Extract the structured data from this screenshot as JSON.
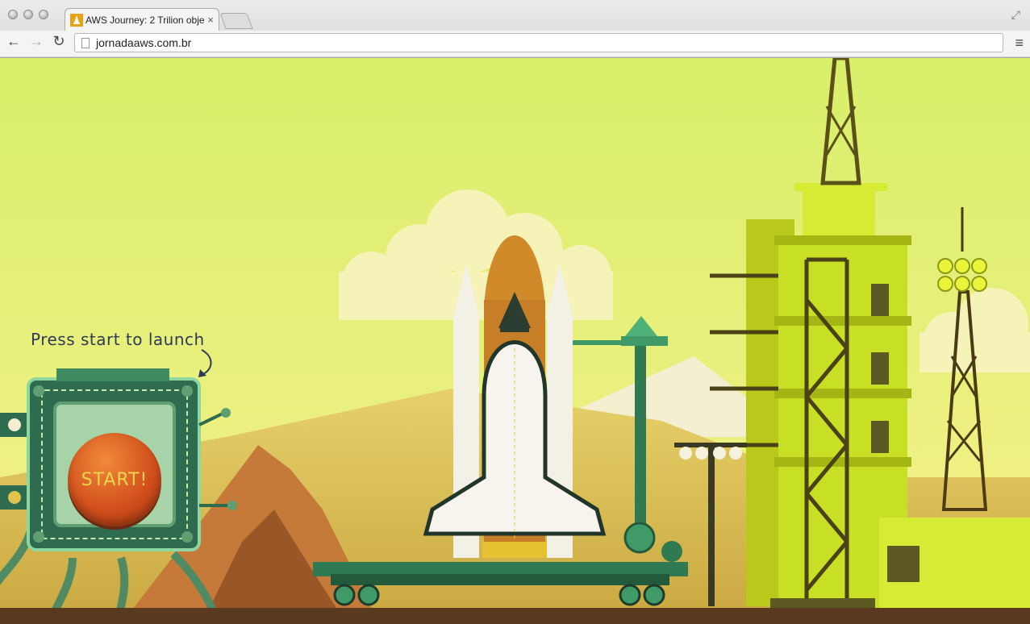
{
  "browser": {
    "tab": {
      "title": "AWS Journey: 2 Trilion obje",
      "close": "×"
    },
    "address": {
      "url": "jornadaaws.com.br"
    },
    "nav": {
      "back": "←",
      "forward": "→",
      "reload": "↻",
      "menu": "≡",
      "fullscreen": "⤢"
    }
  },
  "page": {
    "caption": "Press start to launch",
    "start_label": "START!"
  },
  "colors": {
    "sky_top": "#d8ef6a",
    "sky_bottom": "#f6f08c",
    "ground": "#5a3a1e",
    "tower": "#c7df24",
    "panel": "#2f6b4f",
    "button": "#d3501d"
  },
  "icons": [
    "back-arrow-icon",
    "forward-arrow-icon",
    "reload-icon",
    "page-icon",
    "menu-icon",
    "fullscreen-icon",
    "rocket-favicon-icon"
  ]
}
